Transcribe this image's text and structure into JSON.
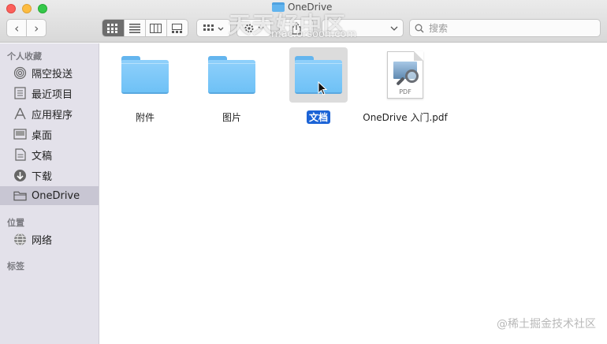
{
  "window": {
    "title": "OneDrive"
  },
  "toolbar": {
    "back_label": "‹",
    "forward_label": "›",
    "search_placeholder": "搜索"
  },
  "watermark": {
    "top_text": "天天好中区",
    "top_sub": "mac.orsoon.com",
    "bottom_text": "@稀土掘金技术社区"
  },
  "sidebar": {
    "favorites_header": "个人收藏",
    "items": [
      {
        "label": "隔空投送",
        "icon": "airdrop-icon"
      },
      {
        "label": "最近项目",
        "icon": "recents-icon"
      },
      {
        "label": "应用程序",
        "icon": "applications-icon"
      },
      {
        "label": "桌面",
        "icon": "desktop-icon"
      },
      {
        "label": "文稿",
        "icon": "documents-icon"
      },
      {
        "label": "下载",
        "icon": "downloads-icon"
      },
      {
        "label": "OneDrive",
        "icon": "folder-icon"
      }
    ],
    "locations_header": "位置",
    "locations": [
      {
        "label": "网络",
        "icon": "network-icon"
      }
    ],
    "tags_header": "标签"
  },
  "files": [
    {
      "label": "附件",
      "type": "folder"
    },
    {
      "label": "图片",
      "type": "folder"
    },
    {
      "label": "文档",
      "type": "folder",
      "selected": true
    },
    {
      "label": "OneDrive 入门.pdf",
      "type": "pdf",
      "badge": "PDF"
    }
  ],
  "colors": {
    "selection": "#1b63d6",
    "folder": "#6ec1f6",
    "sidebar_bg": "#e3e1ea"
  }
}
